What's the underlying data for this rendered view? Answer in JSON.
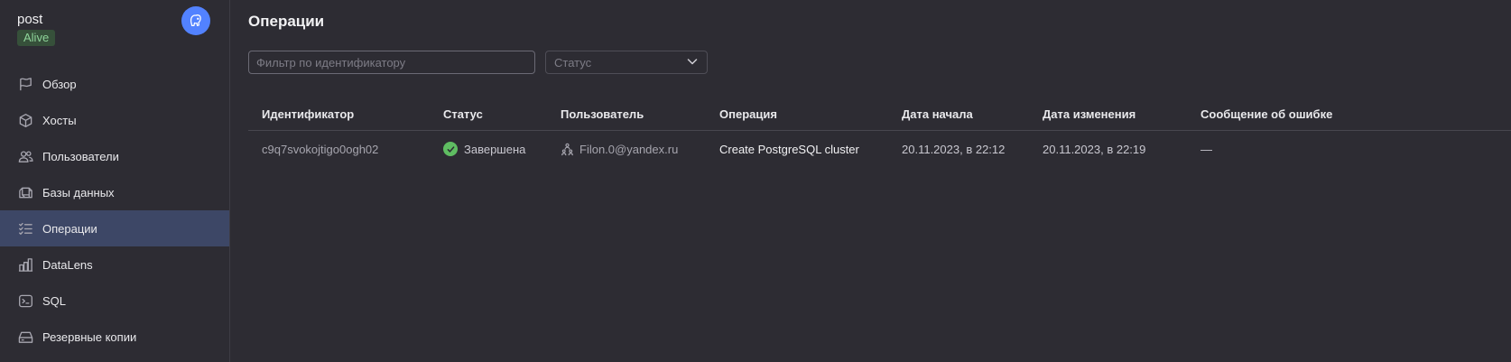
{
  "cluster": {
    "name": "post",
    "status": "Alive"
  },
  "colors": {
    "background": "#2d2c33",
    "active_nav": "#3d4766",
    "accent_blue": "#5282ff",
    "success_green": "#5fbd62"
  },
  "sidebar": {
    "items": [
      {
        "label": "Обзор",
        "icon": "flag-icon"
      },
      {
        "label": "Хосты",
        "icon": "cube-icon"
      },
      {
        "label": "Пользователи",
        "icon": "users-icon"
      },
      {
        "label": "Базы данных",
        "icon": "databases-icon"
      },
      {
        "label": "Операции",
        "icon": "operations-list-icon",
        "active": true
      },
      {
        "label": "DataLens",
        "icon": "bar-chart-icon"
      },
      {
        "label": "SQL",
        "icon": "terminal-icon"
      },
      {
        "label": "Резервные копии",
        "icon": "backup-drive-icon"
      }
    ]
  },
  "main": {
    "title": "Операции",
    "filter": {
      "placeholder": "Фильтр по идентификатору",
      "value": ""
    },
    "status_select": {
      "placeholder": "Статус"
    },
    "table": {
      "columns": [
        "Идентификатор",
        "Статус",
        "Пользователь",
        "Операция",
        "Дата начала",
        "Дата изменения",
        "Сообщение об ошибке"
      ],
      "rows": [
        {
          "id": "c9q7svokojtigo0ogh02",
          "status": "Завершена",
          "user": "Filon.0@yandex.ru",
          "operation": "Create PostgreSQL cluster",
          "started": "20.11.2023, в 22:12",
          "modified": "20.11.2023, в 22:19",
          "error": "—"
        }
      ]
    }
  }
}
